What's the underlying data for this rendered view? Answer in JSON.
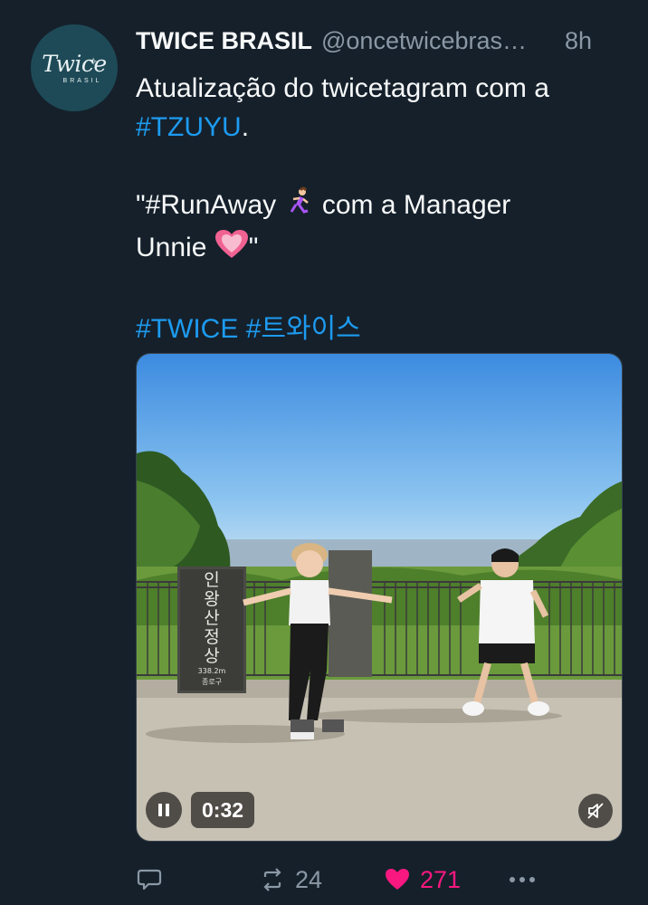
{
  "tweet": {
    "avatar": {
      "logo_text": "Twice",
      "logo_sub": "BRASIL"
    },
    "author_name": "TWICE BRASIL",
    "handle": "@oncetwicebras…",
    "time": "8h",
    "line1": "Atualização do twicetagram com a",
    "tag_tzuyu": "#TZUYU",
    "tag_tzuyu_suffix": ".",
    "quote_part1": "\"#RunAway ",
    "quote_part2": " com a Manager",
    "quote_part3": "Unnie ",
    "quote_part4": "\"",
    "tag_twice": "#TWICE",
    "tag_korean": "#트와이스"
  },
  "media": {
    "duration": "0:32",
    "sign_lines": [
      "인",
      "왕",
      "산",
      "정",
      "상"
    ],
    "sign_height": "338.2m",
    "sign_bottom": "종로구"
  },
  "actions": {
    "retweet_count": "24",
    "like_count": "271"
  },
  "colors": {
    "background": "#15202b",
    "link": "#1d9bf0",
    "secondary": "#8b98a5",
    "like": "#f91880"
  },
  "icons": {
    "reply": "reply-icon",
    "retweet": "retweet-icon",
    "like": "heart-icon",
    "more": "more-icon",
    "pause": "pause-icon",
    "mute": "muted-speaker-icon",
    "runner": "woman-running-emoji",
    "heart": "growing-heart-emoji"
  }
}
